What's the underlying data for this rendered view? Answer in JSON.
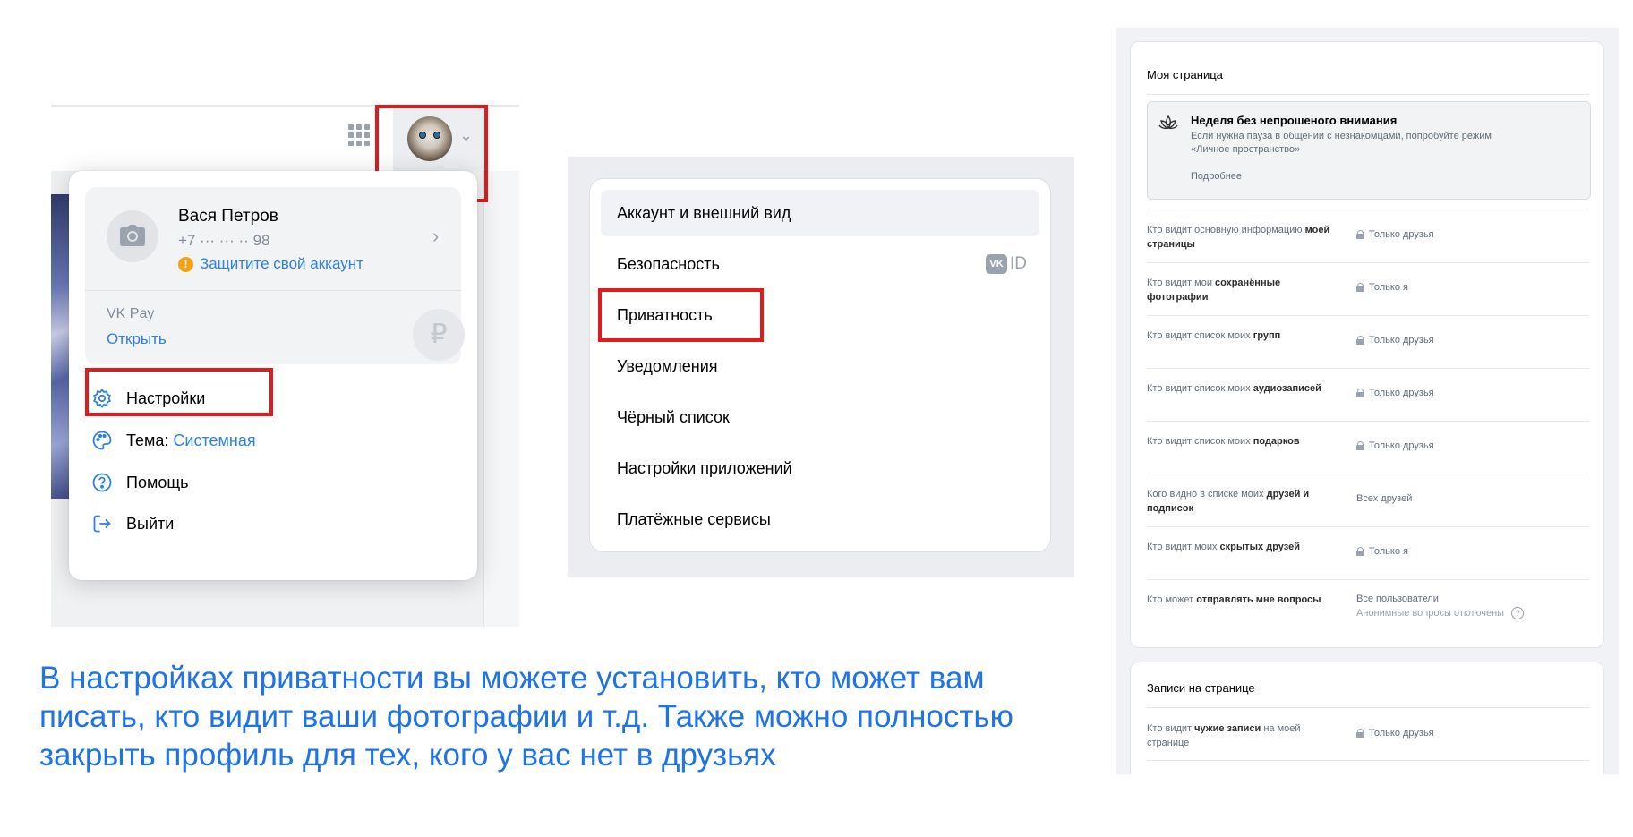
{
  "dropdown": {
    "profile": {
      "name": "Вася Петров",
      "phone": "+7 ··· ··· ·· 98",
      "protect_link": "Защитите свой аккаунт",
      "warn_glyph": "!"
    },
    "vkpay": {
      "label": "VK Pay",
      "open": "Открыть",
      "ruble_glyph": "₽"
    },
    "menu": {
      "settings": "Настройки",
      "theme_label": "Тема:",
      "theme_value": "Системная",
      "help": "Помощь",
      "logout": "Выйти"
    }
  },
  "settings_menu": {
    "items": [
      "Аккаунт и внешний вид",
      "Безопасность",
      "Приватность",
      "Уведомления",
      "Чёрный список",
      "Настройки приложений",
      "Платёжные сервисы"
    ],
    "vkid_badge": {
      "vk": "VK",
      "id": "ID"
    }
  },
  "caption": "В настройках приватности вы можете установить, кто может вам писать, кто видит ваши фотографии и т.д. Также можно полностью закрыть профиль для тех, кого у вас нет в друзьях",
  "privacy": {
    "section_my_page": "Моя страница",
    "banner": {
      "title": "Неделя без непрошеного внимания",
      "text": "Если нужна пауза в общении с незнакомцами, попробуйте режим «Личное пространство»",
      "more": "Подробнее"
    },
    "rows": [
      {
        "label_plain": "Кто видит основную информацию ",
        "label_bold": "моей страницы",
        "value": "Только друзья",
        "locked": true
      },
      {
        "label_plain": "Кто видит мои ",
        "label_bold": "сохранённые фотографии",
        "value": "Только я",
        "locked": true
      },
      {
        "label_plain": "Кто видит список моих ",
        "label_bold": "групп",
        "value": "Только друзья",
        "locked": true
      },
      {
        "label_plain": "Кто видит список моих ",
        "label_bold": "аудиозаписей",
        "value": "Только друзья",
        "locked": true
      },
      {
        "label_plain": "Кто видит список моих ",
        "label_bold": "подарков",
        "value": "Только друзья",
        "locked": true
      },
      {
        "label_plain": "Кого видно в списке моих ",
        "label_bold": "друзей и подписок",
        "value": "Всех друзей",
        "locked": false
      },
      {
        "label_plain": "Кто видит моих ",
        "label_bold": "скрытых друзей",
        "value": "Только я",
        "locked": true
      },
      {
        "label_plain": "Кто может ",
        "label_bold": "отправлять мне вопросы",
        "value": "Все пользователи",
        "value_sub": "Анонимные вопросы отключены",
        "locked": false
      }
    ],
    "section_wall": "Записи на странице",
    "wall_rows": [
      {
        "label_plain": "Кто видит ",
        "label_bold": "чужие записи",
        "label_tail": " на моей странице",
        "value": "Только друзья",
        "locked": true
      }
    ],
    "qmark": "?"
  },
  "colors": {
    "accent": "#2d81e0",
    "caption": "#1f73e8",
    "highlight": "#e01b1b"
  }
}
